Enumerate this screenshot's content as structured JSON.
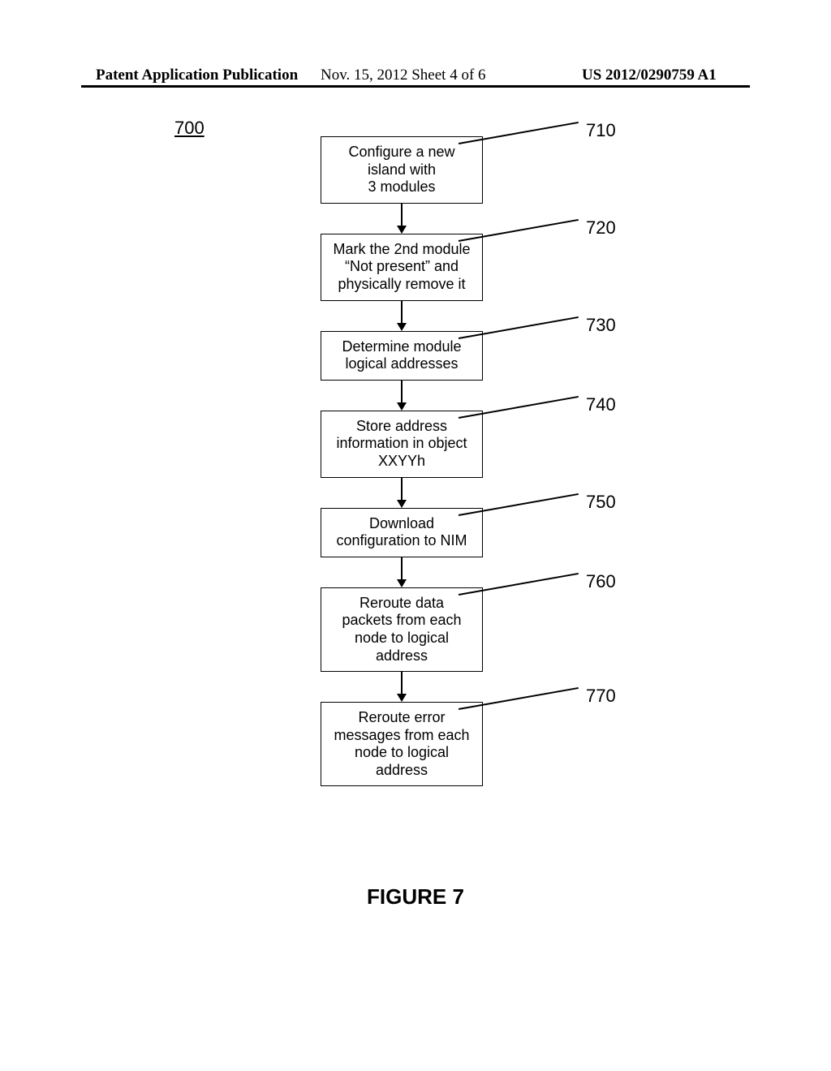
{
  "header": {
    "left": "Patent Application Publication",
    "mid": "Nov. 15, 2012   Sheet 4 of 6",
    "right": "US 2012/0290759 A1"
  },
  "figure_ref": "700",
  "steps": [
    {
      "text": "Configure a new\nisland with\n3 modules",
      "num": "710"
    },
    {
      "text": "Mark the 2nd module\n“Not present” and\nphysically remove it",
      "num": "720"
    },
    {
      "text": "Determine module\nlogical addresses",
      "num": "730"
    },
    {
      "text": "Store address\ninformation in object\nXXYYh",
      "num": "740"
    },
    {
      "text": "Download\nconfiguration to NIM",
      "num": "750"
    },
    {
      "text": "Reroute data\npackets from each\nnode to logical\naddress",
      "num": "760"
    },
    {
      "text": "Reroute error\nmessages from each\nnode to logical\naddress",
      "num": "770"
    }
  ],
  "caption": "FIGURE 7"
}
